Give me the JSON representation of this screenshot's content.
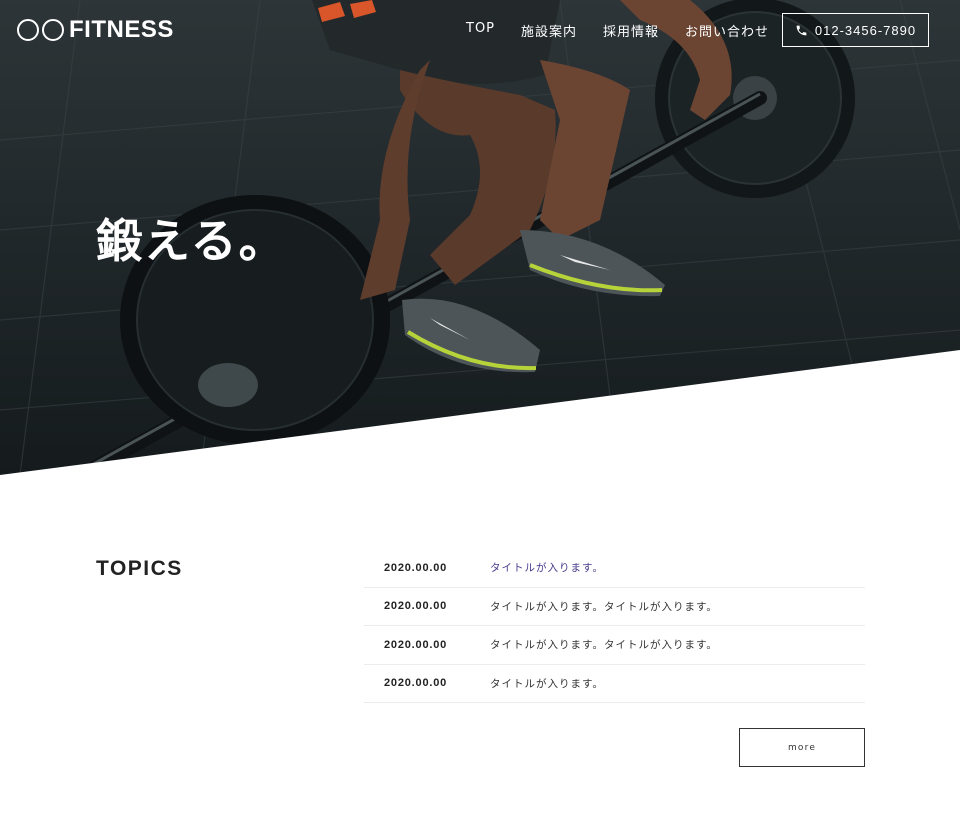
{
  "header": {
    "logo_circles": "○○",
    "logo_text": "FITNESS",
    "nav": [
      "TOP",
      "施設案内",
      "採用情報",
      "お問い合わせ"
    ],
    "phone": "012-3456-7890",
    "phone_icon": "phone-icon"
  },
  "hero": {
    "headline": "鍛える。",
    "image": "barbell-deadlift-photo"
  },
  "topics": {
    "heading": "TOPICS",
    "items": [
      {
        "date": "2020.00.00",
        "title": "タイトルが入ります。"
      },
      {
        "date": "2020.00.00",
        "title": "タイトルが入ります。タイトルが入ります。"
      },
      {
        "date": "2020.00.00",
        "title": "タイトルが入ります。タイトルが入ります。"
      },
      {
        "date": "2020.00.00",
        "title": "タイトルが入ります。"
      }
    ],
    "more_label": "more"
  },
  "colors": {
    "hero_dark": "#1f2629",
    "accent_link": "#4b3a8c",
    "text": "#222222"
  }
}
